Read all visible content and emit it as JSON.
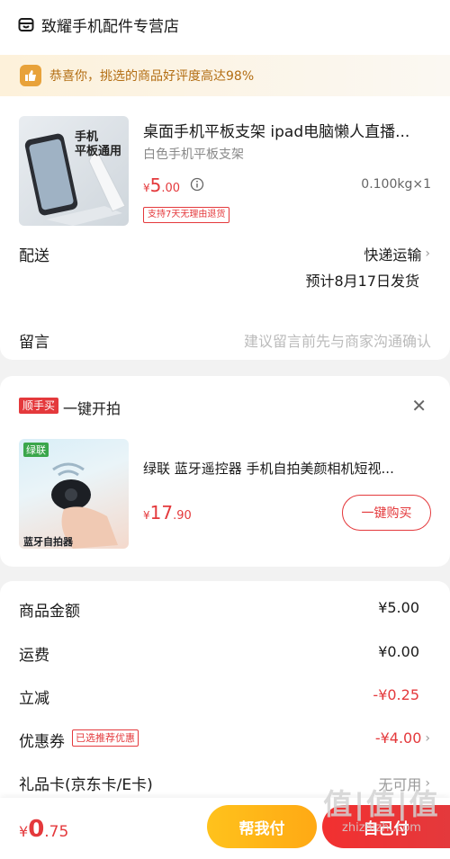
{
  "shop": {
    "icon": "shop-icon",
    "name": "致耀手机配件专营店"
  },
  "banner": {
    "icon": "thumbs-up-icon",
    "text": "恭喜你，挑选的商品好评度高达98%"
  },
  "product": {
    "image_lines": [
      "手机",
      "平板通用"
    ],
    "title": "桌面手机平板支架 ipad电脑懒人直播...",
    "sku": "白色手机平板支架",
    "currency": "¥",
    "price_int": "5",
    "price_dec": ".00",
    "weight_qty": "0.100kg×1",
    "return_tag": "支持7天无理由退货"
  },
  "delivery": {
    "label": "配送",
    "method": "快递运输",
    "estimate": "预计8月17日发货"
  },
  "message": {
    "label": "留言",
    "placeholder": "建议留言前先与商家沟通确认"
  },
  "upsell": {
    "badge": "顺手买",
    "title": "一键开拍",
    "product_title": "绿联 蓝牙遥控器 手机自拍美颜相机短视...",
    "image_brand": "绿联",
    "image_caption": "蓝牙自拍器",
    "currency": "¥",
    "price_int": "17",
    "price_dec": ".90",
    "button": "一键购买"
  },
  "summary": {
    "goods_label": "商品金额",
    "goods_value": "¥5.00",
    "shipping_label": "运费",
    "shipping_value": "¥0.00",
    "discount_label": "立减",
    "discount_value": "-¥0.25",
    "coupon_label": "优惠券",
    "coupon_tag": "已选推荐优惠",
    "coupon_value": "-¥4.00",
    "giftcard_label": "礼品卡(京东卡/E卡)",
    "giftcard_value": "无可用"
  },
  "footer": {
    "currency": "¥",
    "total_int": "0",
    "total_dec": ".75",
    "help_pay": "帮我付",
    "pay": "自己付"
  },
  "watermark": {
    "big": "值|值|值",
    "site": "zhizhizhi.com"
  },
  "colors": {
    "accent_red": "#e4393c",
    "banner_text": "#b36e14",
    "help_button": "#ffb51a"
  }
}
